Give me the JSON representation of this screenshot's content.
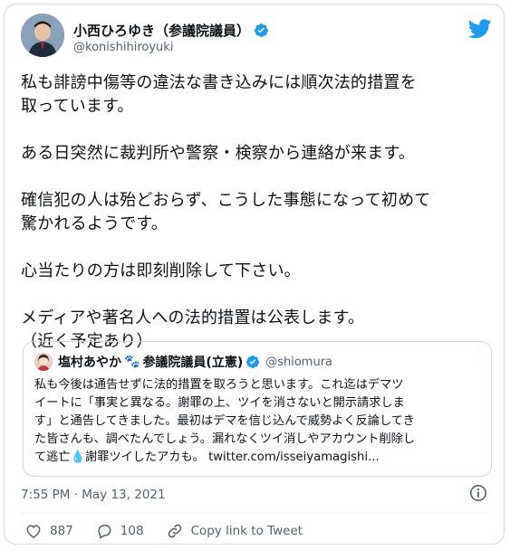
{
  "author": {
    "name": "小西ひろゆき（参議院議員）",
    "handle": "@konishihiroyuki"
  },
  "tweet": {
    "text": "私も誹謗中傷等の違法な書き込みには順次法的措置を\n取っています。\n\nある日突然に裁判所や警察・検察から連絡が来ます。\n\n確信犯の人は殆どおらず、こうした事態になって初めて\n驚かれるようです。\n\n心当たりの方は即刻削除して下さい。\n\nメディアや著名人への法的措置は公表します。\n（近く予定あり）",
    "timestamp": "7:55 PM · May 13, 2021"
  },
  "quoted": {
    "name": "塩村あやか",
    "paw": "🐾",
    "name_suffix": "参議院議員(立憲)",
    "handle": "@shiomura",
    "text_main": "私も今後は通告せずに法的措置を取ろうと思います。これ迄はデマツ\nイートに「事実と異なる。謝罪の上、ツイを消さないと開示請求しま\nす」と通告してきました。最初はデマを信じ込んで威勢よく反論してき\nた皆さんも、調べたんでしょう。漏れなくツイ消しやアカウント削除し\nて逃亡",
    "droplet": "💧",
    "text_tail": "謝罪ツイしたアカも。 ",
    "link": "twitter.com/isseiyamagishi..."
  },
  "actions": {
    "likes": "887",
    "replies": "108",
    "copy_link": "Copy link to Tweet"
  },
  "colors": {
    "twitter_blue": "#1d9bf0",
    "secondary_text": "#536471",
    "border": "#cfd9de"
  },
  "icons": [
    "verified-badge-icon",
    "twitter-bird-icon",
    "info-icon",
    "heart-icon",
    "reply-icon",
    "link-icon"
  ]
}
